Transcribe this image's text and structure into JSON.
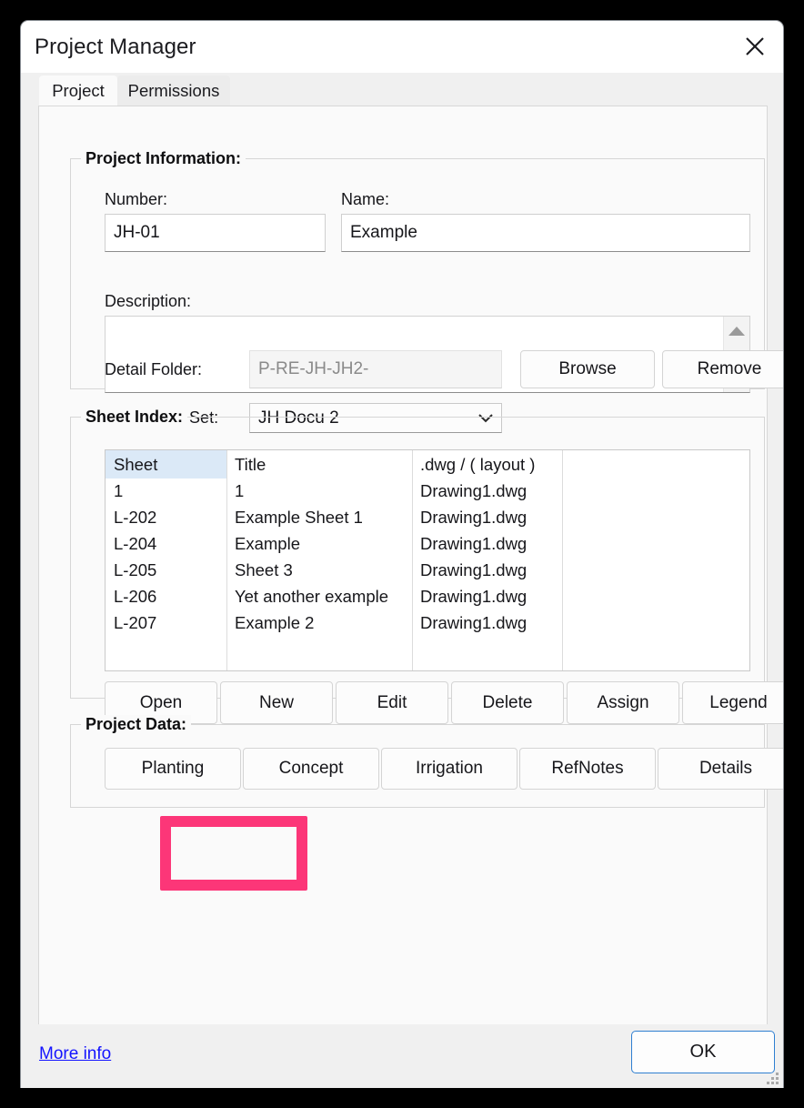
{
  "window": {
    "title": "Project Manager",
    "close_icon": "close-icon"
  },
  "tabs": [
    {
      "label": "Project",
      "active": true
    },
    {
      "label": "Permissions",
      "active": false
    }
  ],
  "project_information": {
    "legend": "Project Information:",
    "number_label": "Number:",
    "number_value": "JH-01",
    "name_label": "Name:",
    "name_value": "Example",
    "description_label": "Description:",
    "description_value": "",
    "description_placeholder": "",
    "scroll_up_icon": "triangle-up-icon",
    "scroll_down_icon": "triangle-down-icon",
    "detail_folder_label": "Detail Folder:",
    "detail_folder_value": "P-RE-JH-JH2-",
    "browse_label": "Browse",
    "remove_label": "Remove",
    "preference_set_label": "Preference Set:",
    "preference_set_value": "JH Docu 2",
    "preference_set_arrow_icon": "chevron-down-icon"
  },
  "sheet_index": {
    "legend": "Sheet Index:",
    "columns": [
      "Sheet",
      "Title",
      ".dwg / ( layout )",
      ""
    ],
    "selected_column": "Sheet",
    "rows": [
      {
        "sheet": "1",
        "title": "1",
        "dwg": "Drawing1.dwg"
      },
      {
        "sheet": "L-202",
        "title": "Example Sheet 1",
        "dwg": "Drawing1.dwg"
      },
      {
        "sheet": "L-204",
        "title": "Example",
        "dwg": "Drawing1.dwg"
      },
      {
        "sheet": "L-205",
        "title": "Sheet 3",
        "dwg": "Drawing1.dwg"
      },
      {
        "sheet": "L-206",
        "title": "Yet another example",
        "dwg": "Drawing1.dwg"
      },
      {
        "sheet": "L-207",
        "title": "Example 2",
        "dwg": "Drawing1.dwg"
      }
    ],
    "buttons": [
      "Open",
      "New",
      "Edit",
      "Delete",
      "Assign",
      "Legend"
    ],
    "highlighted_button": "New",
    "highlight_color": "#fc3678"
  },
  "project_data": {
    "legend": "Project Data:",
    "buttons": [
      "Planting",
      "Concept",
      "Irrigation",
      "RefNotes",
      "Details"
    ]
  },
  "footer": {
    "more_info_label": "More info",
    "ok_label": "OK",
    "link_color": "#1414ff",
    "ok_focus_color": "#2f7fd1",
    "resize_grip_icon": "resize-grip-icon"
  }
}
